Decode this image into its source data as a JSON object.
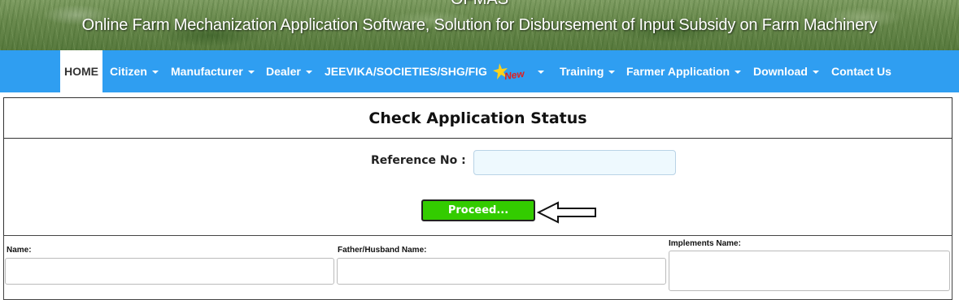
{
  "banner": {
    "abbr": "OFMAS",
    "title": "Online Farm Mechanization Application Software, Solution for Disbursement of Input Subsidy on Farm Machinery"
  },
  "nav": {
    "home": "HOME",
    "citizen": "Citizen",
    "manufacturer": "Manufacturer",
    "dealer": "Dealer",
    "jeevika": "JEEVIKA/SOCIETIES/SHG/FIG",
    "new_badge": "New",
    "training": "Training",
    "farmer_application": "Farmer Application",
    "download": "Download",
    "contact_us": "Contact Us"
  },
  "status": {
    "title": "Check Application Status",
    "reference_label": "Reference No :",
    "reference_value": "",
    "proceed_label": "Proceed..."
  },
  "details": {
    "name_label": "Name:",
    "father_label": "Father/Husband Name:",
    "implements_label": "Implements Name:"
  },
  "colors": {
    "nav_bg": "#2f9ef1",
    "proceed_bg": "#33cc00",
    "input_bg": "#eef9fe"
  }
}
